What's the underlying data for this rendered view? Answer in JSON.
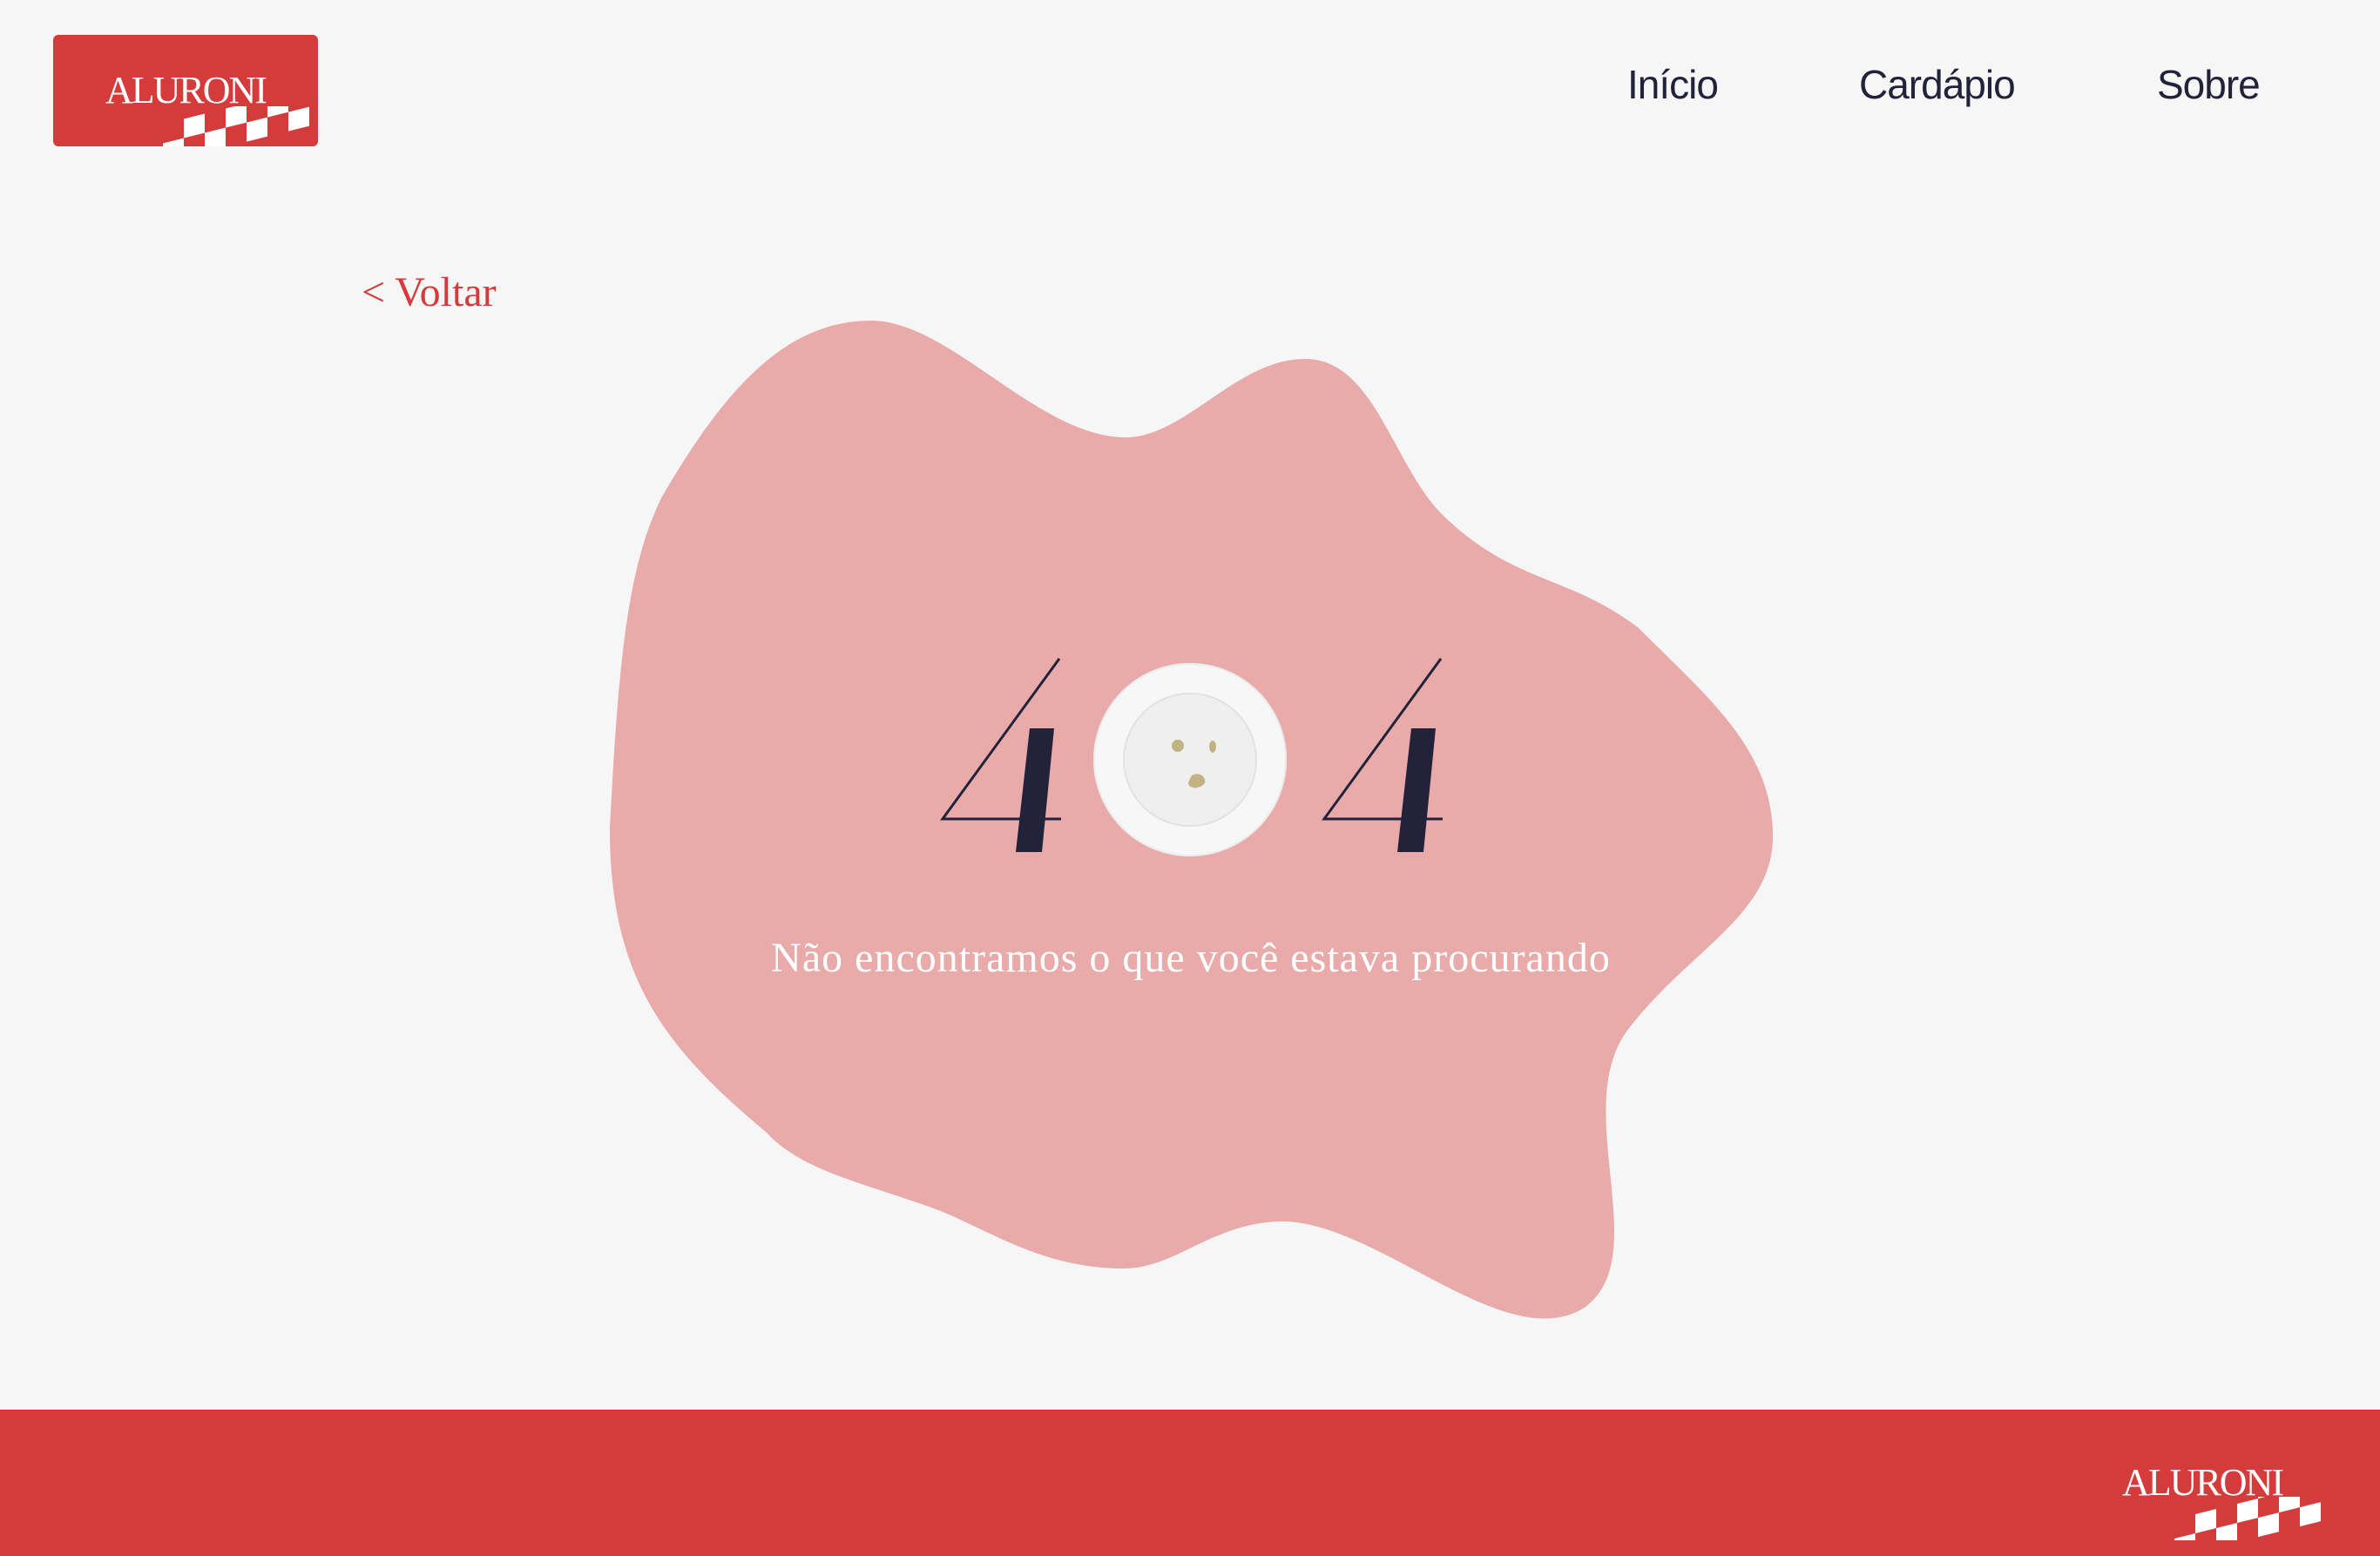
{
  "brand": {
    "name": "ALURONI",
    "accent": "#d63b3c",
    "ink": "#22223a",
    "blob_color": "#e9aaaa"
  },
  "nav": {
    "items": [
      "Início",
      "Cardápio",
      "Sobre"
    ]
  },
  "back": {
    "label": "< Voltar"
  },
  "error": {
    "code_digit_left": "4",
    "code_digit_right": "4",
    "message": "Não encontramos o que você estava procurando",
    "plate_icon": "plate-icon"
  },
  "footer": {
    "brand": "ALURONI"
  }
}
